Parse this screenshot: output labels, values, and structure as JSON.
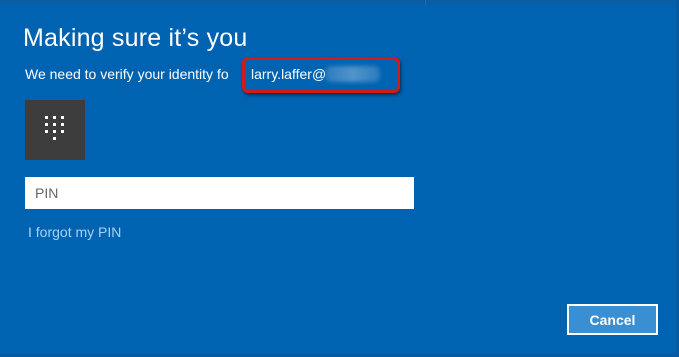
{
  "dialog": {
    "title": "Making sure it’s you",
    "subtitle": "We need to verify your identity fo",
    "email_visible": "larry.laffer@",
    "email_redacted": true
  },
  "pin_tile": {
    "icon": "keypad-icon"
  },
  "pin_input": {
    "placeholder": "PIN",
    "value": ""
  },
  "forgot_pin_link": "I forgot my PIN",
  "buttons": {
    "cancel": "Cancel"
  },
  "colors": {
    "dialog_background": "#0063b1",
    "tile_background": "#3d3d3d",
    "link": "#a9d1f5",
    "highlight_border": "#d31a1a",
    "cancel_background": "#3a8fd3"
  }
}
